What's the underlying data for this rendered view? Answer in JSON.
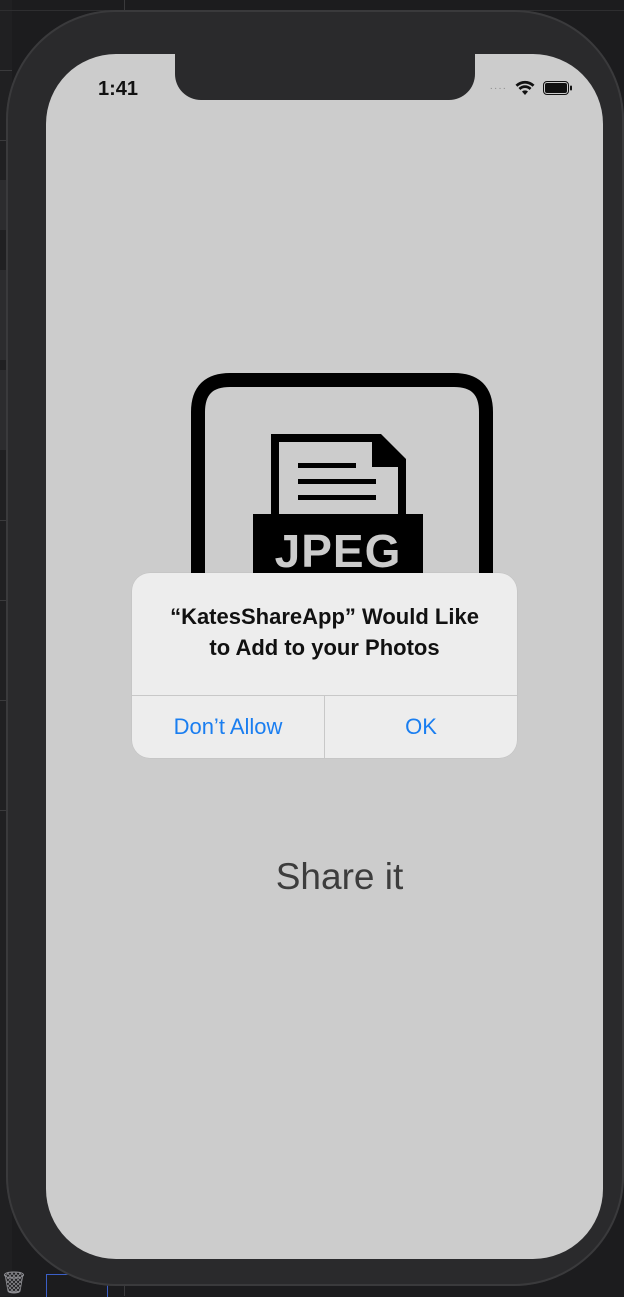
{
  "status_bar": {
    "time": "1:41"
  },
  "content": {
    "image_label": "JPEG",
    "share_label": "Share it"
  },
  "alert": {
    "title_line1": "“KatesShareApp” Would Like",
    "title_line2": "to Add to your Photos",
    "deny_label": "Don’t Allow",
    "ok_label": "OK"
  },
  "colors": {
    "screen_bg": "#cccccc",
    "alert_bg": "#ededed",
    "button_blue": "#1a7ef0"
  }
}
